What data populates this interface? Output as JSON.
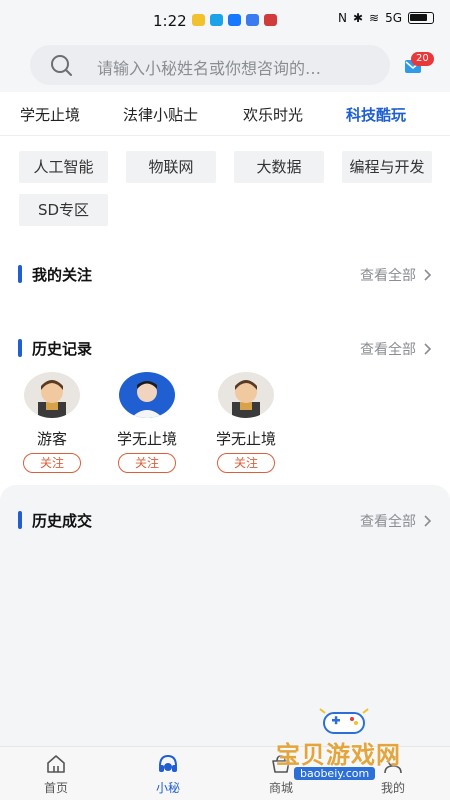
{
  "status_bar": {
    "time": "1:22",
    "network": "5G"
  },
  "search": {
    "placeholder": "请输入小秘姓名或你想咨询的…",
    "badge_count": "20"
  },
  "tabs": [
    {
      "label": "学无止境",
      "active": false
    },
    {
      "label": "法律小贴士",
      "active": false
    },
    {
      "label": "欢乐时光",
      "active": false
    },
    {
      "label": "科技酷玩",
      "active": true
    }
  ],
  "categories": [
    "人工智能",
    "物联网",
    "大数据",
    "编程与开发",
    "SD专区"
  ],
  "follow_section": {
    "title": "我的关注",
    "see_all": "查看全部"
  },
  "history_section": {
    "title": "历史记录",
    "see_all": "查看全部",
    "items": [
      {
        "name": "游客",
        "action": "关注",
        "avatar_icon": "cartoon-avatar"
      },
      {
        "name": "学无止境",
        "action": "关注",
        "avatar_icon": "photo-avatar"
      },
      {
        "name": "学无止境",
        "action": "关注",
        "avatar_icon": "cartoon-avatar"
      }
    ]
  },
  "deals_section": {
    "title": "历史成交",
    "see_all": "查看全部"
  },
  "bottom_nav": [
    {
      "label": "首页",
      "icon": "home-icon",
      "active": false
    },
    {
      "label": "小秘",
      "icon": "headset-icon",
      "active": true
    },
    {
      "label": "商城",
      "icon": "shop-icon",
      "active": false
    },
    {
      "label": "我的",
      "icon": "profile-icon",
      "active": false
    }
  ],
  "watermark": {
    "text": "宝贝游戏网",
    "url": "baobeiy.com"
  },
  "colors": {
    "accent": "#1f5fd1",
    "follow": "#d9603b",
    "badge": "#e8383a"
  }
}
